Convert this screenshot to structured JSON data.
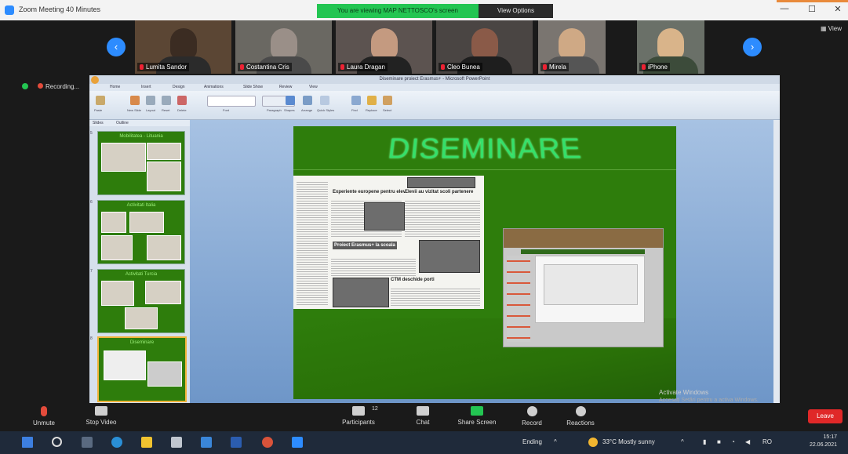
{
  "titlebar": {
    "title": "Zoom Meeting 40 Minutes",
    "share_banner": "You are viewing MAP NETTOSCO's screen",
    "view_options": "View Options",
    "minimize": "—",
    "maximize": "☐",
    "close": "✕"
  },
  "gallery": {
    "prev": "‹",
    "next": "›",
    "view_label": "View",
    "participants": [
      {
        "name": "Lumita Sandor"
      },
      {
        "name": "Costantina Cris"
      },
      {
        "name": "Laura Dragan"
      },
      {
        "name": "Cleo Bunea"
      },
      {
        "name": "Mirela"
      },
      {
        "name": "iPhone"
      }
    ]
  },
  "recording": {
    "label": "Recording..."
  },
  "powerpoint": {
    "title": "Diseminare proiect Erasmus+ - Microsoft PowerPoint",
    "tabs": [
      "Home",
      "Insert",
      "Design",
      "Animations",
      "Slide Show",
      "Review",
      "View"
    ],
    "ribbon_groups": [
      "Paste",
      "New Slide",
      "Layout",
      "Reset",
      "Delete",
      "Font",
      "Paragraph",
      "Shapes",
      "Arrange",
      "Quick Styles",
      "Find",
      "Replace",
      "Select"
    ],
    "panel_tabs": [
      "Slides",
      "Outline"
    ],
    "slide_numbers": [
      "5",
      "6",
      "7",
      "8"
    ],
    "thumbnails": [
      {
        "title": "Mobilitatea - Lituania"
      },
      {
        "title": "Activitati Italia"
      },
      {
        "title": "Activitati Turcia"
      },
      {
        "title": "Diseminare"
      }
    ],
    "slide": {
      "title": "DISEMINARE",
      "headlines": [
        "Experiente europene pentru elevi",
        "Proiect Erasmus+ la scoala",
        "Elevii au vizitat scoli partenere",
        "CTM deschide porti"
      ]
    }
  },
  "toolbar": {
    "unmute": "Unmute",
    "start_video": "Stop Video",
    "participants": "Participants",
    "participants_count": "12",
    "chat": "Chat",
    "share_screen": "Share Screen",
    "record": "Record",
    "reactions": "Reactions",
    "leave": "Leave",
    "activate_windows": "Activate Windows",
    "activate_sub": "Accesați Setări pentru a activa Windows."
  },
  "taskbar": {
    "ending": "Ending",
    "weather": "33°C  Mostly sunny",
    "lang": "RO",
    "time": "15:17",
    "date": "22.06.2021"
  },
  "colors": {
    "zoom_blue": "#2d8cff",
    "share_green": "#23c552",
    "slide_green": "#2e7d0c",
    "slide_title": "#35e06a",
    "leave_red": "#e02828"
  }
}
